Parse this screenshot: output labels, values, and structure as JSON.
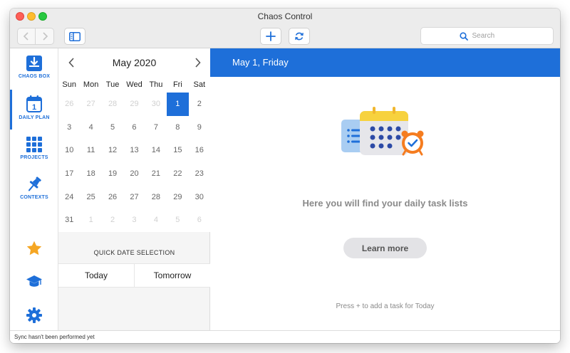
{
  "window": {
    "title": "Chaos Control"
  },
  "toolbar": {
    "back_icon": "chevron-left-icon",
    "forward_icon": "chevron-right-icon",
    "sidebar_toggle_icon": "sidebar-icon",
    "add_icon": "plus-icon",
    "sync_icon": "sync-icon",
    "search_placeholder": "Search"
  },
  "sidebar": {
    "items": [
      {
        "id": "chaos-box",
        "label": "CHAOS BOX",
        "icon": "inbox-download-icon"
      },
      {
        "id": "daily-plan",
        "label": "DAILY PLAN",
        "icon": "calendar-day-icon",
        "icon_text": "1",
        "active": true
      },
      {
        "id": "projects",
        "label": "PROJECTS",
        "icon": "grid-icon"
      },
      {
        "id": "contexts",
        "label": "CONTEXTS",
        "icon": "pushpin-icon"
      }
    ],
    "bottom_icons": [
      "star-icon",
      "graduation-cap-icon",
      "gear-icon"
    ]
  },
  "calendar": {
    "month_label": "May 2020",
    "weekdays": [
      "Sun",
      "Mon",
      "Tue",
      "Wed",
      "Thu",
      "Fri",
      "Sat"
    ],
    "cells": [
      {
        "d": "26",
        "out": true
      },
      {
        "d": "27",
        "out": true
      },
      {
        "d": "28",
        "out": true
      },
      {
        "d": "29",
        "out": true
      },
      {
        "d": "30",
        "out": true
      },
      {
        "d": "1",
        "sel": true
      },
      {
        "d": "2"
      },
      {
        "d": "3"
      },
      {
        "d": "4"
      },
      {
        "d": "5"
      },
      {
        "d": "6"
      },
      {
        "d": "7"
      },
      {
        "d": "8"
      },
      {
        "d": "9"
      },
      {
        "d": "10"
      },
      {
        "d": "11"
      },
      {
        "d": "12"
      },
      {
        "d": "13"
      },
      {
        "d": "14"
      },
      {
        "d": "15"
      },
      {
        "d": "16"
      },
      {
        "d": "17"
      },
      {
        "d": "18"
      },
      {
        "d": "19"
      },
      {
        "d": "20"
      },
      {
        "d": "21"
      },
      {
        "d": "22"
      },
      {
        "d": "23"
      },
      {
        "d": "24"
      },
      {
        "d": "25"
      },
      {
        "d": "26"
      },
      {
        "d": "27"
      },
      {
        "d": "28"
      },
      {
        "d": "29"
      },
      {
        "d": "30"
      },
      {
        "d": "31"
      },
      {
        "d": "1",
        "out": true
      },
      {
        "d": "2",
        "out": true
      },
      {
        "d": "3",
        "out": true
      },
      {
        "d": "4",
        "out": true
      },
      {
        "d": "5",
        "out": true
      },
      {
        "d": "6",
        "out": true
      }
    ],
    "quick_title": "QUICK DATE SELECTION",
    "quick_today": "Today",
    "quick_tomorrow": "Tomorrow"
  },
  "main": {
    "header": "May 1, Friday",
    "illustration_icon": "calendar-alarm-illustration-icon",
    "empty_message": "Here you will find your daily task lists",
    "learn_more": "Learn more",
    "hint": "Press + to add a task for Today"
  },
  "status": {
    "text": "Sync hasn't been performed yet"
  },
  "colors": {
    "accent": "#1e6fd9",
    "star": "#f5a623",
    "alarm": "#f57c1f",
    "calendar_top": "#f7d23e"
  }
}
